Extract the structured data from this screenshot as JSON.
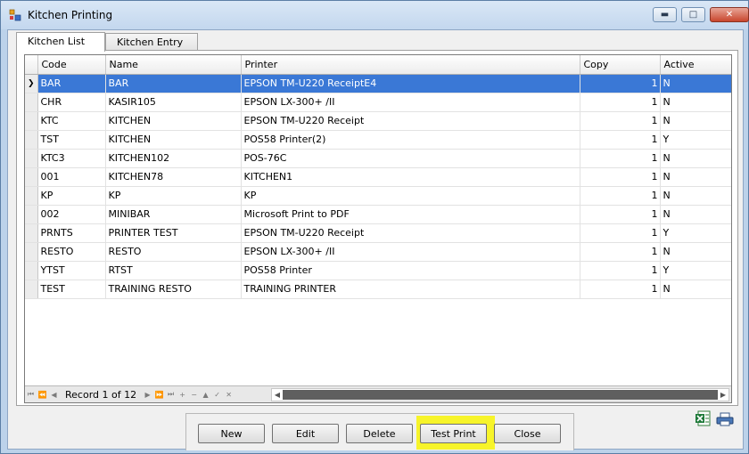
{
  "window": {
    "title": "Kitchen Printing",
    "minimize_icon": "minimize-icon",
    "maximize_icon": "maximize-icon",
    "close_icon": "close-icon"
  },
  "tabs": [
    {
      "label": "Kitchen List",
      "active": true
    },
    {
      "label": "Kitchen Entry",
      "active": false
    }
  ],
  "grid": {
    "columns": [
      "Code",
      "Name",
      "Printer",
      "Copy",
      "Active"
    ],
    "selected_row": 0,
    "rows": [
      {
        "code": "BAR",
        "name": "BAR",
        "printer": "EPSON TM-U220 ReceiptE4",
        "copy": "1",
        "active": "N"
      },
      {
        "code": "CHR",
        "name": "KASIR105",
        "printer": "EPSON LX-300+ /II",
        "copy": "1",
        "active": "N"
      },
      {
        "code": "KTC",
        "name": "KITCHEN",
        "printer": "EPSON TM-U220 Receipt",
        "copy": "1",
        "active": "N"
      },
      {
        "code": "TST",
        "name": "KITCHEN",
        "printer": "POS58 Printer(2)",
        "copy": "1",
        "active": "Y"
      },
      {
        "code": "KTC3",
        "name": "KITCHEN102",
        "printer": "POS-76C",
        "copy": "1",
        "active": "N"
      },
      {
        "code": "001",
        "name": "KITCHEN78",
        "printer": "KITCHEN1",
        "copy": "1",
        "active": "N"
      },
      {
        "code": "KP",
        "name": "KP",
        "printer": "KP",
        "copy": "1",
        "active": "N"
      },
      {
        "code": "002",
        "name": "MINIBAR",
        "printer": "Microsoft Print to PDF",
        "copy": "1",
        "active": "N"
      },
      {
        "code": "PRNTS",
        "name": "PRINTER TEST",
        "printer": "EPSON TM-U220 Receipt",
        "copy": "1",
        "active": "Y"
      },
      {
        "code": "RESTO",
        "name": "RESTO",
        "printer": "EPSON LX-300+ /II",
        "copy": "1",
        "active": "N"
      },
      {
        "code": "YTST",
        "name": "RTST",
        "printer": "POS58 Printer",
        "copy": "1",
        "active": "Y"
      },
      {
        "code": "TEST",
        "name": "TRAINING RESTO",
        "printer": "TRAINING PRINTER",
        "copy": "1",
        "active": "N"
      }
    ]
  },
  "navigator": {
    "record_text": "Record 1 of 12"
  },
  "buttons": {
    "new": "New",
    "edit": "Edit",
    "delete": "Delete",
    "test_print": "Test Print",
    "close": "Close"
  },
  "colors": {
    "selection": "#3a78d6",
    "highlight": "#f7f42a",
    "window_frame": "#bcd2ea"
  },
  "icons": {
    "excel_export": "excel-icon",
    "print_preview": "printer-icon"
  }
}
